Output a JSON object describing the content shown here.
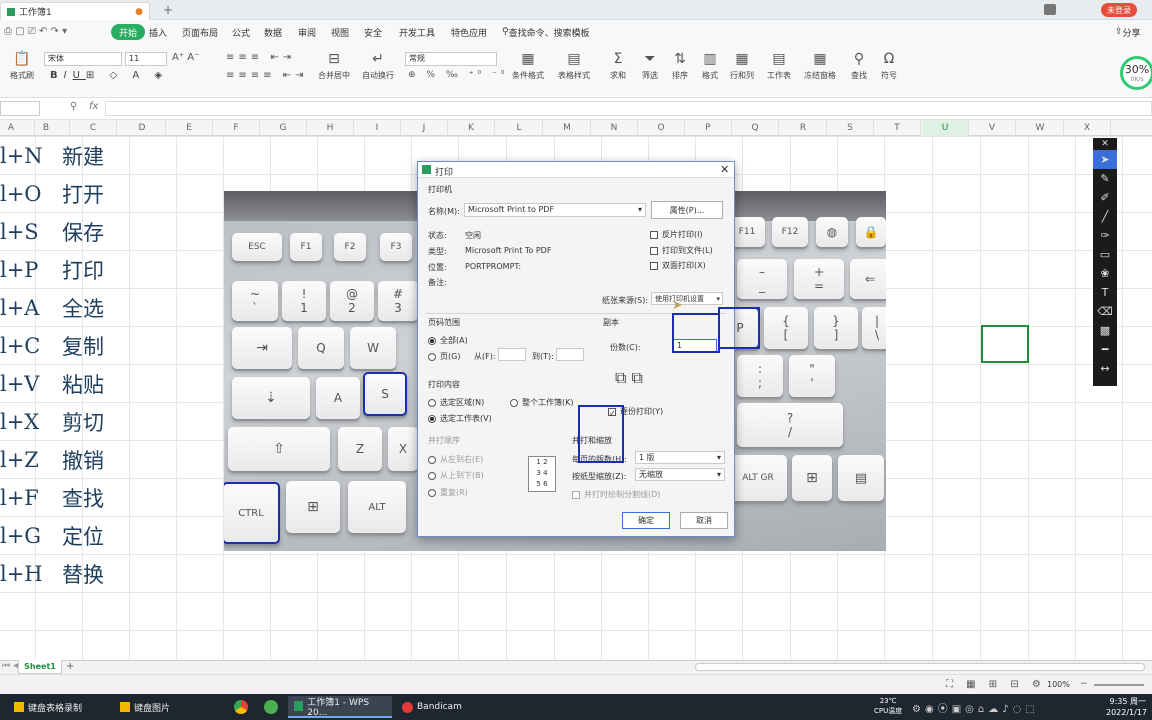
{
  "titlebar": {
    "tab_label": "工作簿1",
    "login_btn": "未登录",
    "tab_add": "+"
  },
  "menubar": {
    "items": [
      "开始",
      "插入",
      "页面布局",
      "公式",
      "数据",
      "审阅",
      "视图",
      "安全",
      "开发工具",
      "特色应用"
    ],
    "active": "开始",
    "search": "查找命令、搜索模板",
    "share": "分享"
  },
  "ribbon": {
    "paste": "粘贴",
    "format_painter": "格式刷",
    "font": "宋体",
    "size": "11",
    "number_format": "常规",
    "merge": "合并居中",
    "wrap": "自动换行",
    "cond_format": "条件格式",
    "table_style": "表格样式",
    "sum": "求和",
    "filter": "筛选",
    "sort": "排序",
    "format": "格式",
    "rowcol": "行和列",
    "worksheet": "工作表",
    "freeze": "冻结窗格",
    "find": "查找",
    "symbol": "符号",
    "perf": "30%",
    "perf_sub": "0K/s"
  },
  "formula": {
    "fx": "fx"
  },
  "columns": [
    "A",
    "B",
    "C",
    "D",
    "E",
    "F",
    "G",
    "H",
    "I",
    "J",
    "K",
    "L",
    "M",
    "N",
    "O",
    "P",
    "Q",
    "R",
    "S",
    "T",
    "U",
    "V",
    "W",
    "X"
  ],
  "cells": [
    {
      "a": "l+N",
      "b": "新建"
    },
    {
      "a": "l+O",
      "b": "打开"
    },
    {
      "a": "l+S",
      "b": "保存"
    },
    {
      "a": "l+P",
      "b": "打印"
    },
    {
      "a": "l+A",
      "b": "全选"
    },
    {
      "a": "l+C",
      "b": "复制"
    },
    {
      "a": "l+V",
      "b": "粘贴"
    },
    {
      "a": "l+X",
      "b": "剪切"
    },
    {
      "a": "l+Z",
      "b": "撤销"
    },
    {
      "a": "l+F",
      "b": "查找"
    },
    {
      "a": "l+G",
      "b": "定位"
    },
    {
      "a": "l+H",
      "b": "替换"
    }
  ],
  "photo_keys": {
    "esc": "ESC",
    "f1": "F1",
    "f2": "F2",
    "f3": "F3",
    "f11": "F11",
    "f12": "F12",
    "tilde_top": "~",
    "tilde_bot": "`",
    "one_top": "!",
    "one": "1",
    "two_top": "@",
    "two": "2",
    "three_top": "#",
    "three": "3",
    "tab": "⇥",
    "q": "Q",
    "w": "W",
    "caps": "⇣",
    "a": "A",
    "s": "S",
    "shift": "⇧",
    "z": "Z",
    "x": "X",
    "ctrl": "CTRL",
    "alt": "ALT",
    "altgr": "ALT GR",
    "p": "P",
    "minus": "–",
    "minus_bot": "_",
    "plus": "+",
    "eq": "=",
    "lbrace": "{",
    "lbrack": "[",
    "rbrace": "}",
    "rbrack": "]",
    "pipe": "|",
    "bslash": "\\",
    "colon": ":",
    "semi": ";",
    "quote": "\"",
    "apos": "'",
    "question": "?",
    "slash": "/",
    "backspace": "⇐"
  },
  "dialog": {
    "title": "打印",
    "printer_group": "打印机",
    "name_label": "名称(M):",
    "printer_name": "Microsoft Print to PDF",
    "properties_btn": "属性(P)...",
    "status_label": "状态:",
    "status_value": "空闲",
    "type_label": "类型:",
    "type_value": "Microsoft Print To PDF",
    "location_label": "位置:",
    "location_value": "PORTPROMPT:",
    "comment_label": "备注:",
    "reverse_print": "反片打印(I)",
    "print_to_file": "打印到文件(L)",
    "duplex": "双面打印(X)",
    "paper_source_label": "纸张来源(S):",
    "paper_source": "使用打印机设置",
    "page_range_group": "页码范围",
    "all": "全部(A)",
    "pages": "页(G)",
    "from": "从(F):",
    "to": "到(T):",
    "copies_group": "副本",
    "copies_label": "份数(C):",
    "copies_value": "1",
    "collate": "逐份打印(Y)",
    "print_content_group": "打印内容",
    "selection": "选定区域(N)",
    "whole_workbook": "整个工作簿(K)",
    "active_sheet": "选定工作表(V)",
    "print_order_group": "并打顺序",
    "left_to_right": "从左到右(E)",
    "top_to_bottom": "从上到下(B)",
    "repeat": "重复(R)",
    "zoom_group": "并打和缩放",
    "pages_per_sheet_label": "每页的版数(H):",
    "pages_per_sheet": "1 版",
    "scale_label": "按纸型缩放(Z):",
    "scale_value": "无缩放",
    "draw_borders": "并打时绘制分割线(D)",
    "ok": "确定",
    "cancel": "取消",
    "close": "✕"
  },
  "sheetbar": {
    "sheet": "Sheet1",
    "add": "+"
  },
  "statusbar": {
    "zoom": "100%"
  },
  "taskbar": {
    "items": [
      "键盘表格录制",
      "键盘图片",
      "工作簿1 - WPS 20...",
      "Bandicam"
    ],
    "temp": "23℃",
    "cpu": "CPU温度",
    "time": "9:35 周一",
    "date": "2022/1/17"
  }
}
